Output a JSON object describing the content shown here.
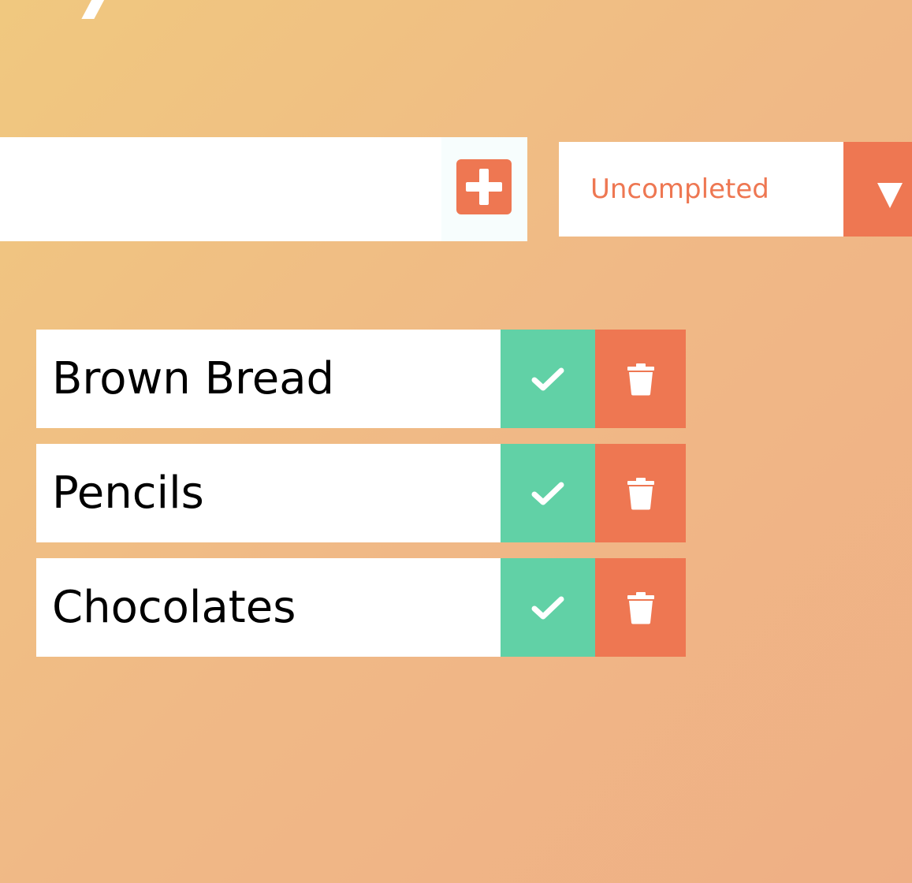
{
  "header": {
    "add_button_icon": "plus-square-icon"
  },
  "new_todo": {
    "value": "",
    "placeholder": ""
  },
  "filter": {
    "selected": "Uncompleted",
    "arrow_icon": "triangle-down-icon"
  },
  "todos": [
    {
      "text": "Brown Bread",
      "complete_icon": "check-icon",
      "delete_icon": "trash-icon"
    },
    {
      "text": "Pencils",
      "complete_icon": "check-icon",
      "delete_icon": "trash-icon"
    },
    {
      "text": "Chocolates",
      "complete_icon": "check-icon",
      "delete_icon": "trash-icon"
    }
  ],
  "colors": {
    "accent": "#ee7752",
    "complete": "#61d1a6",
    "background_start": "#f0c87f",
    "background_end": "#efaf85"
  }
}
